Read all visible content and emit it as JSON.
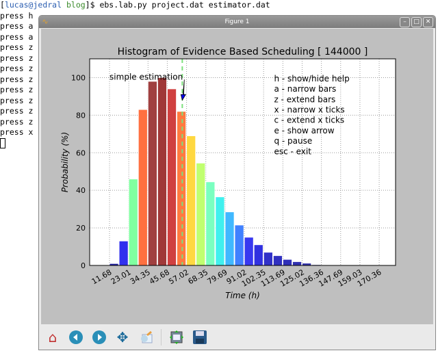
{
  "terminal": {
    "prompt_user": "lucas@jedral",
    "prompt_dir": "blog",
    "command": "ebs.lab.py project.dat estimator.dat",
    "lines": [
      "press h",
      "press a",
      "press a",
      "press z",
      "press z",
      "press z",
      "press z",
      "press z",
      "press z",
      "press z",
      "press z",
      "press x"
    ]
  },
  "window": {
    "title": "Figure 1"
  },
  "toolbar": {
    "buttons": [
      "home-icon",
      "back-icon",
      "forward-icon",
      "pan-icon",
      "zoom-icon",
      "subplots-icon",
      "save-icon"
    ]
  },
  "chart_data": {
    "type": "bar",
    "title": "Histogram of Evidence Based Scheduling [ 144000 ]",
    "xlabel": "Time (h)",
    "ylabel": "Probability (%)",
    "xlim": [
      0,
      180
    ],
    "ylim": [
      0,
      110
    ],
    "xticks": [
      "11.68",
      "23.01",
      "34.35",
      "45.68",
      "57.02",
      "68.35",
      "79.69",
      "91.02",
      "102.35",
      "113.69",
      "125.02",
      "136.36",
      "147.69",
      "159.03",
      "170.36"
    ],
    "yticks": [
      "0",
      "20",
      "40",
      "60",
      "80",
      "100"
    ],
    "bin_start": 11.68,
    "bin_width": 5.67,
    "values": [
      1,
      13,
      46,
      83,
      98,
      100,
      94,
      82,
      69,
      54.5,
      44.5,
      36.5,
      28.5,
      21.5,
      15,
      11,
      7,
      5.2,
      3.2,
      2,
      1.2,
      0.4,
      0.2
    ],
    "colors": [
      "#2020a0",
      "#3030ee",
      "#80ffa0",
      "#ff7040",
      "#a04040",
      "#a03838",
      "#d04040",
      "#ff7a40",
      "#ffd840",
      "#c0ff70",
      "#7affc0",
      "#40f0ee",
      "#40b8ff",
      "#4080ff",
      "#3838f0",
      "#3030e0",
      "#3030c8",
      "#3030c0",
      "#3030b8",
      "#3030b0",
      "#3030a8",
      "#3030a0",
      "#3030a0"
    ],
    "estimate_line": 54.5,
    "annotation": "simple estimation",
    "help": [
      "h - show/hide help",
      "a - narrow bars",
      "z - extend bars",
      "x - narrow x ticks",
      "c - extend x ticks",
      "e - show arrow",
      "q - pause",
      "esc - exit"
    ],
    "grid": true
  }
}
